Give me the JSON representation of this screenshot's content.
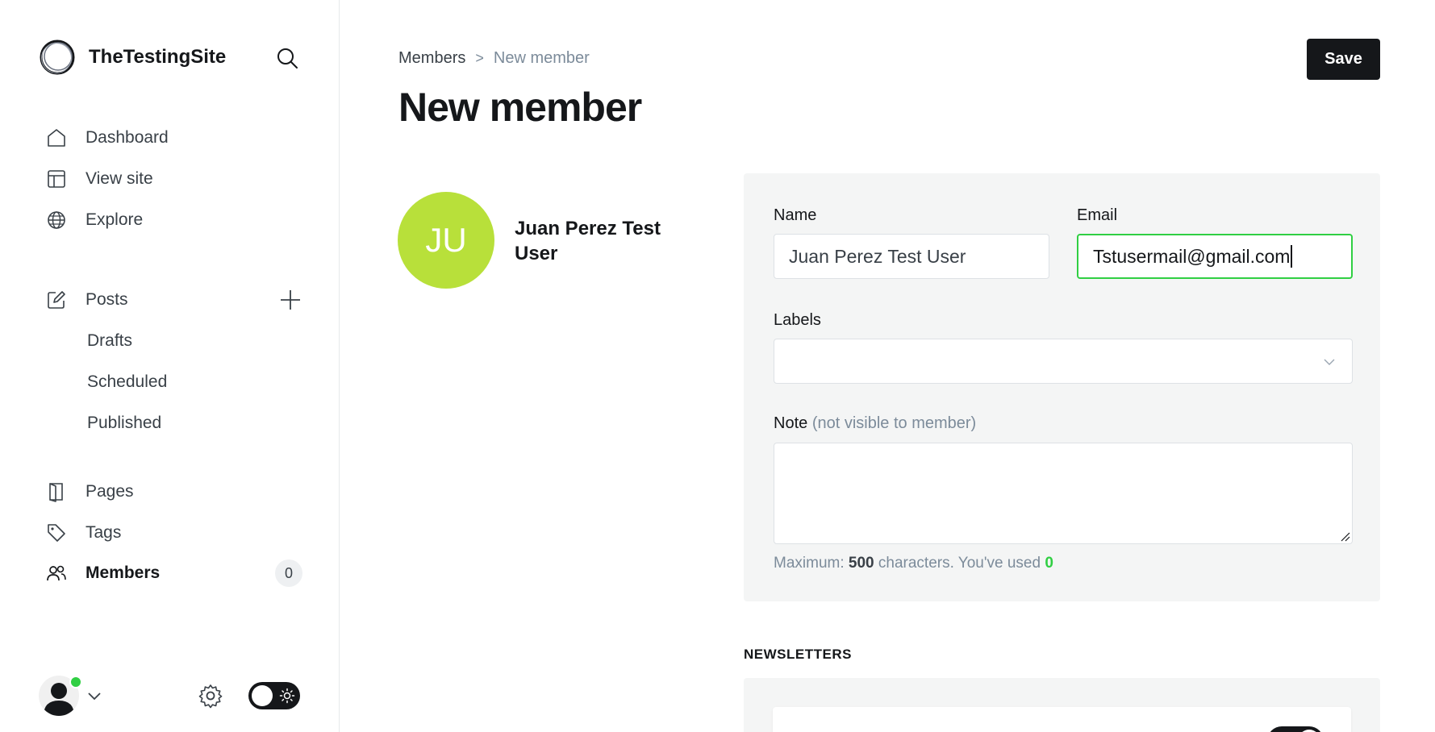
{
  "sidebar": {
    "site_name": "TheTestingSite",
    "items": {
      "dashboard": "Dashboard",
      "view_site": "View site",
      "explore": "Explore",
      "posts": "Posts",
      "drafts": "Drafts",
      "scheduled": "Scheduled",
      "published": "Published",
      "pages": "Pages",
      "tags": "Tags",
      "members": "Members"
    },
    "members_count": "0",
    "icons": {
      "search": "search-icon",
      "dashboard": "home-icon",
      "view_site": "layout-icon",
      "explore": "globe-icon",
      "posts": "pencil-icon",
      "add_post": "plus-icon",
      "pages": "page-icon",
      "tags": "tag-icon",
      "members": "users-icon",
      "settings": "gear-icon",
      "theme": "sun-icon"
    }
  },
  "header": {
    "breadcrumb_parent": "Members",
    "breadcrumb_separator": ">",
    "breadcrumb_current": "New member",
    "title": "New member",
    "save_label": "Save"
  },
  "member": {
    "initials": "JU",
    "display_name": "Juan Perez Test User"
  },
  "form": {
    "name_label": "Name",
    "name_value": "Juan Perez Test User",
    "email_label": "Email",
    "email_value": "Tstusermail@gmail.com",
    "labels_label": "Labels",
    "note_label": "Note",
    "note_hint": "(not visible to member)",
    "char_prefix": "Maximum:",
    "char_max": "500",
    "char_middle": "characters. You've used",
    "char_used": "0"
  },
  "newsletters": {
    "heading": "NEWSLETTERS"
  },
  "colors": {
    "accent_green": "#30cf43",
    "avatar_lime": "#b8e03a",
    "dark": "#15171a"
  }
}
